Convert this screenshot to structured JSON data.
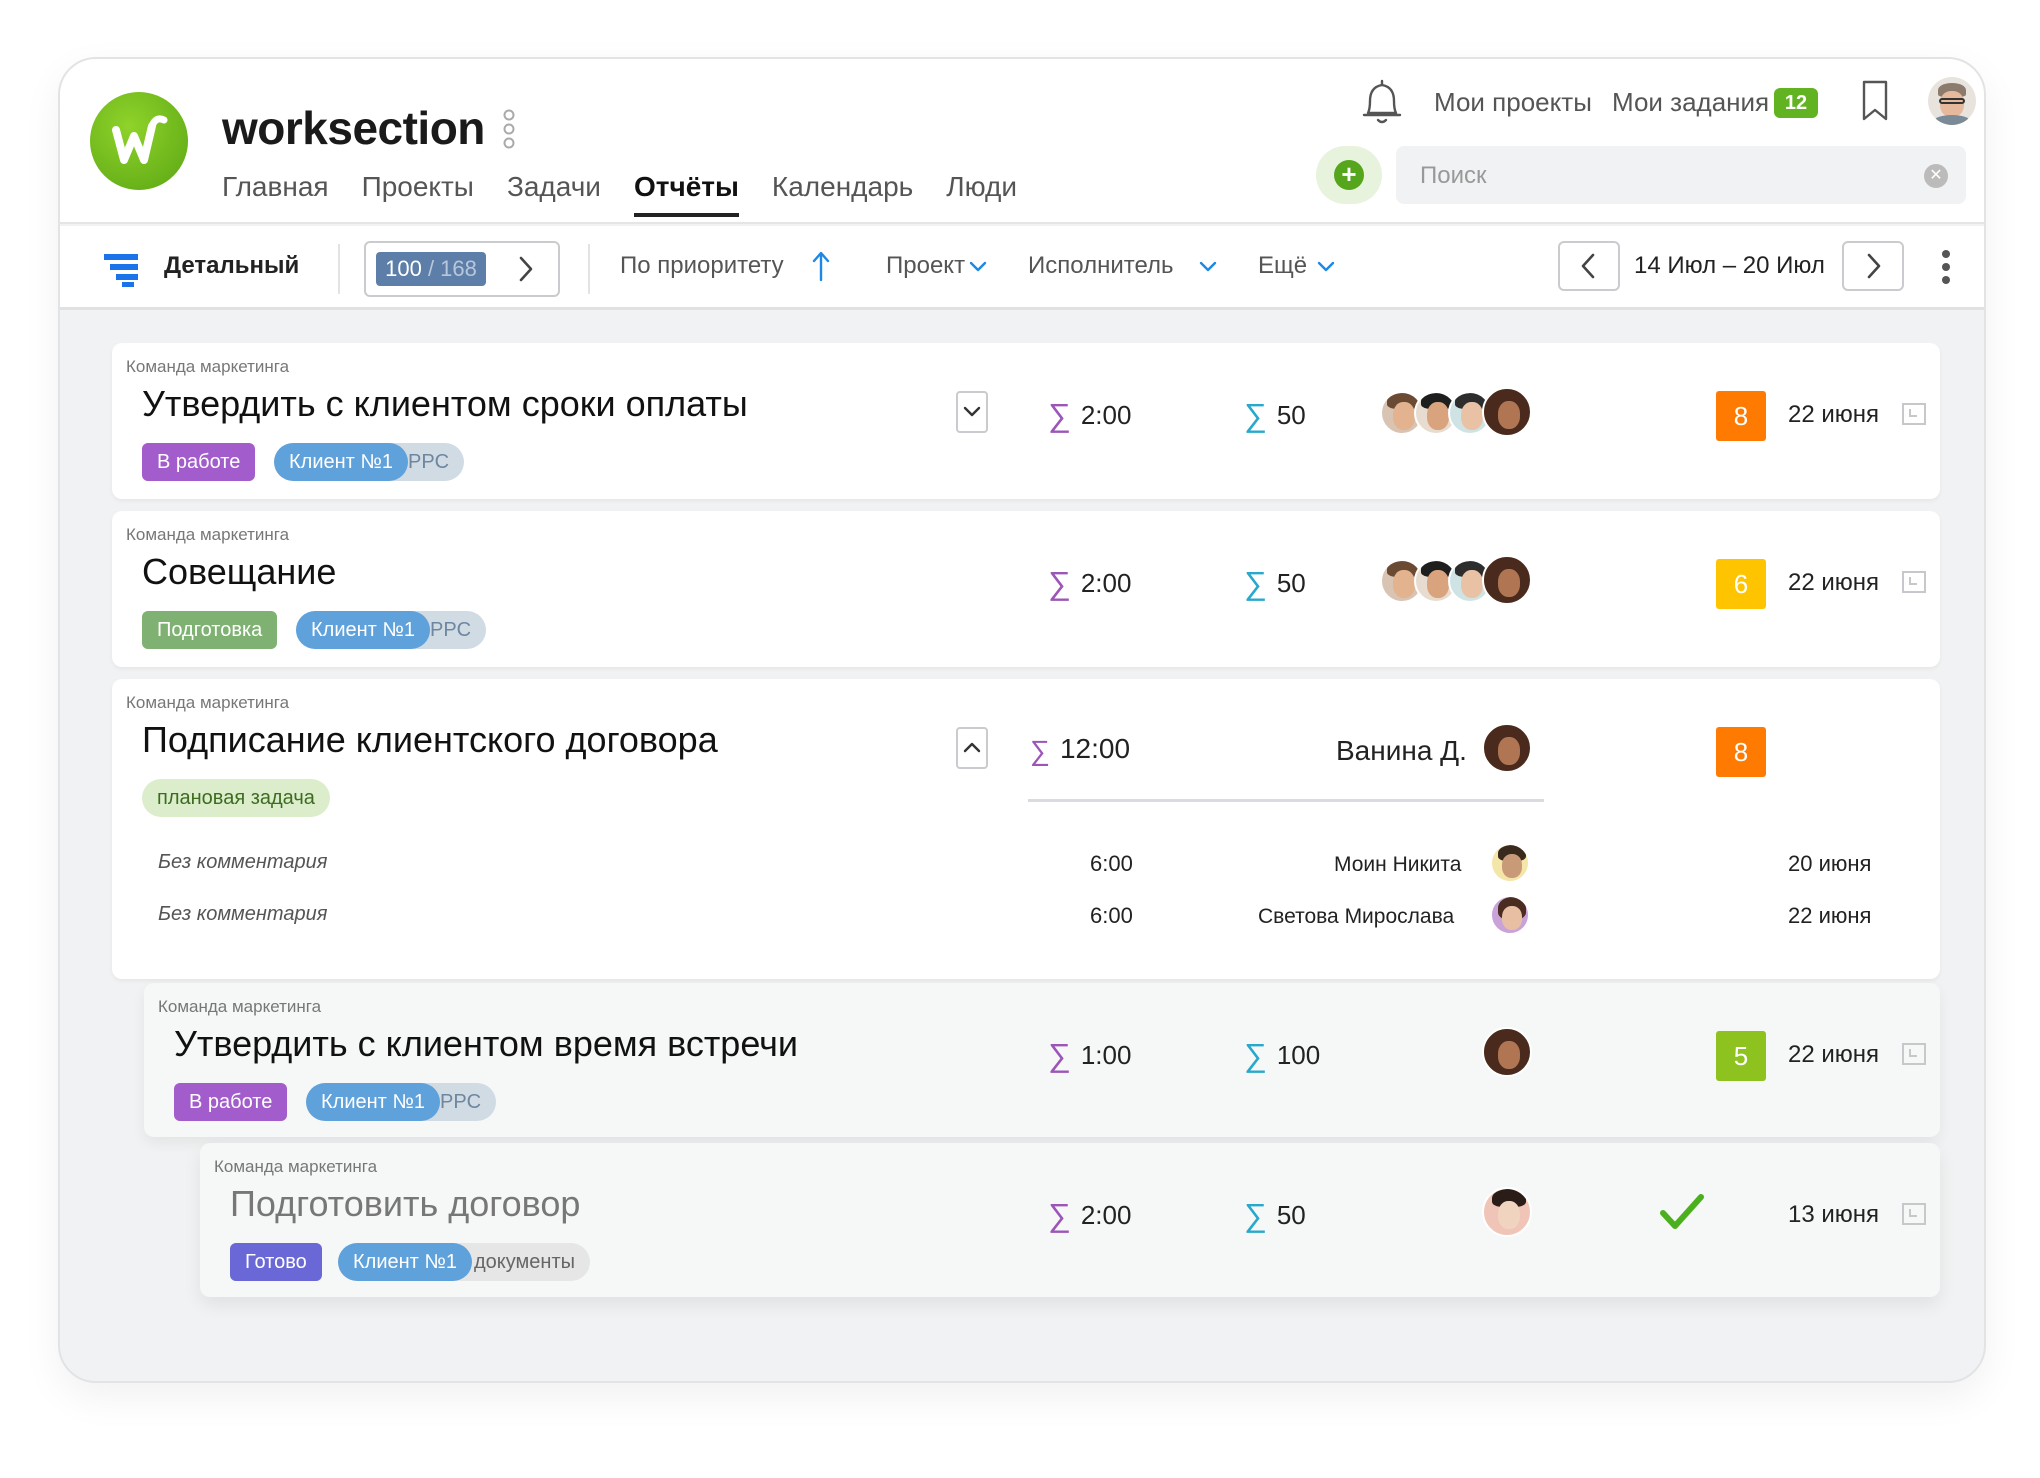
{
  "app": {
    "brand": "worksection",
    "nav": [
      "Главная",
      "Проекты",
      "Задачи",
      "Отчёты",
      "Календарь",
      "Люди"
    ],
    "active_nav": "Отчёты",
    "my_projects": "Мои проекты",
    "my_tasks": "Мои задания",
    "my_tasks_count": "12",
    "search_placeholder": "Поиск"
  },
  "toolbar": {
    "view_label": "Детальный",
    "pager_current": "100",
    "pager_total": "/ 168",
    "sort_label": "По приоритету",
    "filter_project": "Проект",
    "filter_assignee": "Исполнитель",
    "filter_more": "Ещё",
    "date_range": "14 Июл – 20 Июл"
  },
  "tasks": [
    {
      "team": "Команда маркетинга",
      "title": "Утвердить с клиентом сроки оплаты",
      "status": "В работе",
      "client": "Клиент №1",
      "category": "PPC",
      "time": "2:00",
      "cost": "50",
      "priority": "8",
      "date": "22 июня"
    },
    {
      "team": "Команда маркетинга",
      "title": "Совещание",
      "status": "Подготовка",
      "client": "Клиент №1",
      "category": "PPC",
      "time": "2:00",
      "cost": "50",
      "priority": "6",
      "date": "22 июня"
    },
    {
      "team": "Команда маркетинга",
      "title": "Подписание клиентского договора",
      "status": "плановая задача",
      "time": "12:00",
      "assignee": "Ванина Д.",
      "priority": "8",
      "entries": [
        {
          "comment": "Без комментария",
          "time": "6:00",
          "person": "Моин Никита",
          "date": "20 июня"
        },
        {
          "comment": "Без комментария",
          "time": "6:00",
          "person": "Светова Мирослава",
          "date": "22 июня"
        }
      ]
    },
    {
      "team": "Команда маркетинга",
      "title": "Утвердить с клиентом время встречи",
      "status": "В работе",
      "client": "Клиент №1",
      "category": "PPC",
      "time": "1:00",
      "cost": "100",
      "priority": "5",
      "date": "22 июня"
    },
    {
      "team": "Команда маркетинга",
      "title": "Подготовить договор",
      "status": "Готово",
      "client": "Клиент №1",
      "category": "документы",
      "time": "2:00",
      "cost": "50",
      "date": "13 июня"
    }
  ],
  "colors": {
    "accent_green": "#61b322",
    "prio_orange": "#ff7a00",
    "prio_yellow": "#ffc400",
    "prio_lime": "#8dc21f",
    "status_purple": "#a35ccc",
    "status_green": "#7fb272",
    "status_indigo": "#6a68d6",
    "client_blue": "#5ea1db"
  }
}
